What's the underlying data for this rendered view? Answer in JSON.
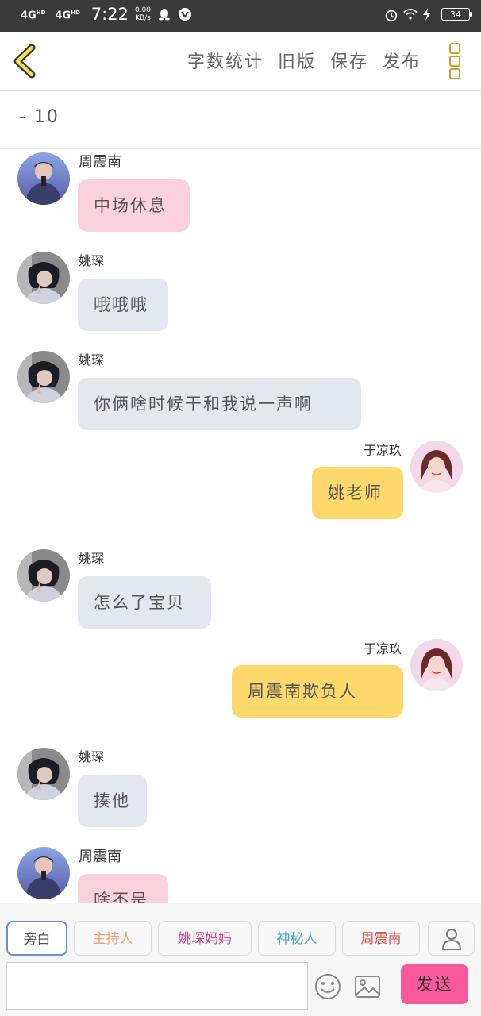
{
  "status_bar": {
    "signal_1": "4G",
    "signal_1_sup": "HD",
    "signal_2": "4G",
    "signal_2_sup": "HD",
    "time": "7:22",
    "speed_value": "0.00",
    "speed_unit": "KB/s",
    "battery": "34"
  },
  "toolbar": {
    "word_count": "字数统计",
    "old_version": "旧版",
    "save": "保存",
    "publish": "发布"
  },
  "counter": "- 10",
  "messages": [
    {
      "side": "left",
      "name": "周震南",
      "text": "中场休息",
      "color": "#fad1dc"
    },
    {
      "side": "left",
      "name": "姚琛",
      "text": "哦哦哦",
      "color": "#e3e8ef"
    },
    {
      "side": "left",
      "name": "姚琛",
      "text": "你俩啥时候干和我说一声啊",
      "color": "#e3e8ef"
    },
    {
      "side": "right",
      "name": "于凉玖",
      "text": "姚老师",
      "color": "#fcd96a"
    },
    {
      "side": "left",
      "name": "姚琛",
      "text": "怎么了宝贝",
      "color": "#e3e8ef"
    },
    {
      "side": "right",
      "name": "于凉玖",
      "text": "周震南欺负人",
      "color": "#fcd96a"
    },
    {
      "side": "left",
      "name": "姚琛",
      "text": "揍他",
      "color": "#e3e8ef"
    },
    {
      "side": "left",
      "name": "周震南",
      "text": "啥不是",
      "color": "#fad1dc"
    }
  ],
  "roles": [
    {
      "label": "旁白",
      "color": "#555555",
      "selected": true
    },
    {
      "label": "主持人",
      "color": "#f0a070",
      "selected": false
    },
    {
      "label": "姚琛妈妈",
      "color": "#d04a90",
      "selected": false
    },
    {
      "label": "神秘人",
      "color": "#4aa8b8",
      "selected": false
    },
    {
      "label": "周震南",
      "color": "#e05050",
      "selected": false
    }
  ],
  "composer": {
    "input_value": "",
    "send_label": "发送"
  }
}
